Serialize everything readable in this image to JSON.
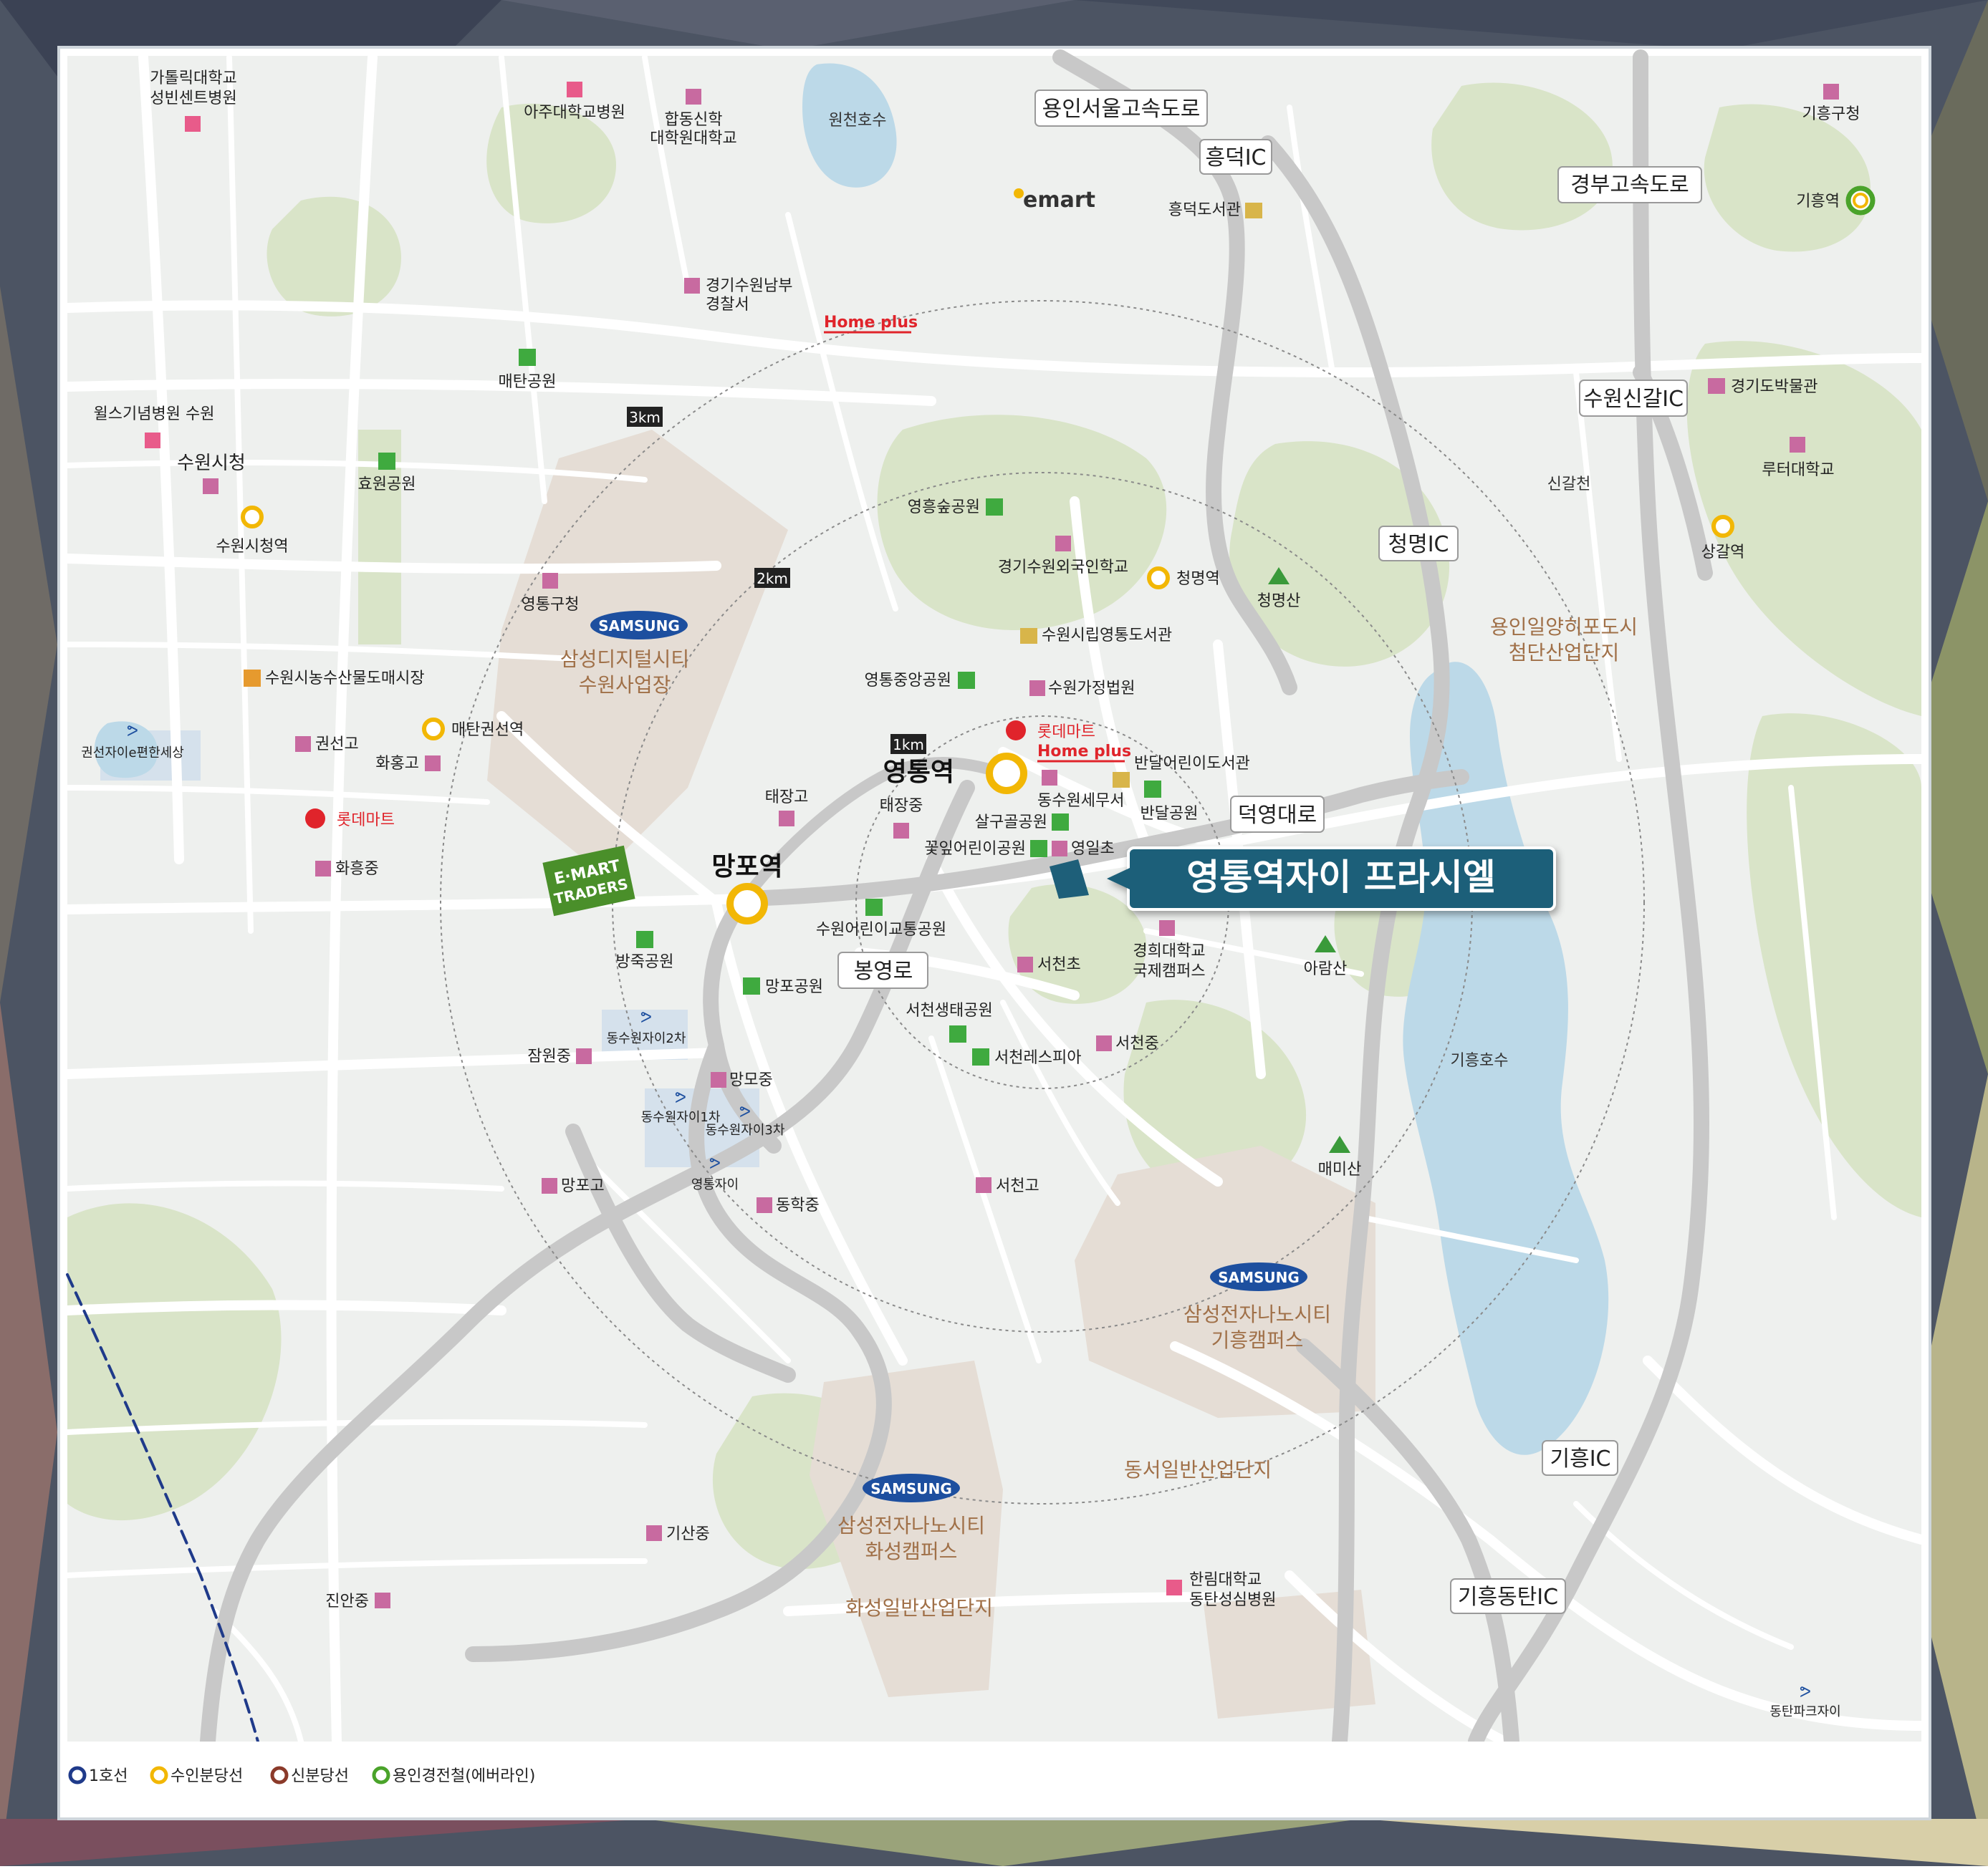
{
  "colors": {
    "background": "#eef0ee",
    "green_area": "#d8e4c6",
    "industrial": "#e4dcd4",
    "water": "#bcd9e8",
    "road": "#ffffff",
    "expressway": "#c8c8c8",
    "highlight": "#1e5f79",
    "line1": "#1f3a8a",
    "bundang": "#f2b705",
    "sinbundang": "#8b3a2a",
    "everline": "#4aa32a",
    "mountain": "#3a9a3a",
    "park": "#3faa3f",
    "school": "#c86aa0",
    "hospital": "#e85b8a",
    "samsung": "#1d4f9f",
    "lotte": "#e0242b",
    "homeplus": "#e0242b",
    "emart": "#f2b705"
  },
  "radius_labels": [
    "3km",
    "2km",
    "1km"
  ],
  "highlight": {
    "label": "영통역자이 프라시엘",
    "icon": "location-pin-icon"
  },
  "road_labels": [
    "용인서울고속도로",
    "흥덕IC",
    "경부고속도로",
    "수원신갈IC",
    "청명IC",
    "덕영대로",
    "봉영로",
    "기흥IC",
    "기흥동탄IC"
  ],
  "stations": {
    "major": [
      "영통역",
      "망포역"
    ],
    "bundang": [
      "수원시청역",
      "매탄권선역",
      "청명역",
      "상갈역"
    ],
    "everline": [
      "기흥역"
    ]
  },
  "brands": {
    "emart": "emart",
    "homeplus": "Home plus",
    "lotte": "롯데마트",
    "samsung": "SAMSUNG",
    "emart_traders": [
      "E·MART",
      "TRADERS"
    ]
  },
  "districts": [
    [
      "삼성디지털시티",
      "수원사업장"
    ],
    [
      "삼성전자나노시티",
      "기흥캠퍼스"
    ],
    [
      "삼성전자나노시티",
      "화성캠퍼스"
    ],
    [
      "용인일양히포도시",
      "첨단산업단지"
    ],
    [
      "동서일반산업단지"
    ],
    [
      "화성일반산업단지"
    ]
  ],
  "places": {
    "catholic_hospital": [
      "가톨릭대학교",
      "성빈센트병원"
    ],
    "ajou_hospital": "아주대학교병원",
    "hapdong": [
      "합동신학",
      "대학원대학교"
    ],
    "wonchon_lake": "원천호수",
    "giheung_gu": "기흥구청",
    "heungdeok_library": "흥덕도서관",
    "police": [
      "경기수원남부",
      "경찰서"
    ],
    "maetan_park": "매탄공원",
    "wills": "윌스기념병원 수원",
    "suwon_city": "수원시청",
    "hyowon_park": "효원공원",
    "gyeonggi_museum": "경기도박물관",
    "luther": "루터대학교",
    "singal": "신갈천",
    "yeongheung_park": "영흥숲공원",
    "foreign_school": "경기수원외국인학교",
    "cheongmyeong_mt": "청명산",
    "yeongtong_library": "수원시립영통도서관",
    "yeongtong_gu": "영통구청",
    "market": "수원시농수산물도매시장",
    "central_park": "영통중앙공원",
    "family_court": "수원가정법원",
    "gwonseon_xi": "권선자이e편한세상",
    "gwonseon_high": "권선고",
    "hwahong_high": "화홍고",
    "bandal_library": "반달어린이도서관",
    "taejang_high": "태장고",
    "taejang_mid": "태장중",
    "dongsuwon_tax": "동수원세무서",
    "bandal_park": "반달공원",
    "salgugol_park": "살구골공원",
    "kkotip_park": "꽃잎어린이공원",
    "yeongil_elem": "영일초",
    "hwaheung_mid": "화흥중",
    "children_park": "수원어린이교통공원",
    "kyunghee": [
      "경희대학교",
      "국제캠퍼스"
    ],
    "arisan": "아람산",
    "bangjuk_park": "방죽공원",
    "seocheon_elem": "서천초",
    "mangpo_park": "망포공원",
    "seocheon_eco": "서천생태공원",
    "dongsuwon_xi2": "동수원자이2차",
    "jamwon_mid": "잠원중",
    "seocheon_mid": "서천중",
    "seocheon_lespia": "서천레스피아",
    "giheung_lake": "기흥호수",
    "mangmo_mid": "망모중",
    "dongsuwon_xi1": "동수원자이1차",
    "dongsuwon_xi3": "동수원자이3차",
    "maemisan": "매미산",
    "yeongtong_xi": "영통자이",
    "mangpo_high": "망포고",
    "donghak_mid": "동학중",
    "seocheon_high": "서천고",
    "gisan_mid": "기산중",
    "hallym": [
      "한림대학교",
      "동탄성심병원"
    ],
    "jinan_mid": "진안중",
    "dongtan_park_xi": "동탄파크자이"
  },
  "legend": [
    {
      "label": "1호선",
      "color": "#1f3a8a"
    },
    {
      "label": "수인분당선",
      "color": "#f2b705"
    },
    {
      "label": "신분당선",
      "color": "#8b3a2a"
    },
    {
      "label": "용인경전철(에버라인)",
      "color": "#4aa32a"
    }
  ]
}
